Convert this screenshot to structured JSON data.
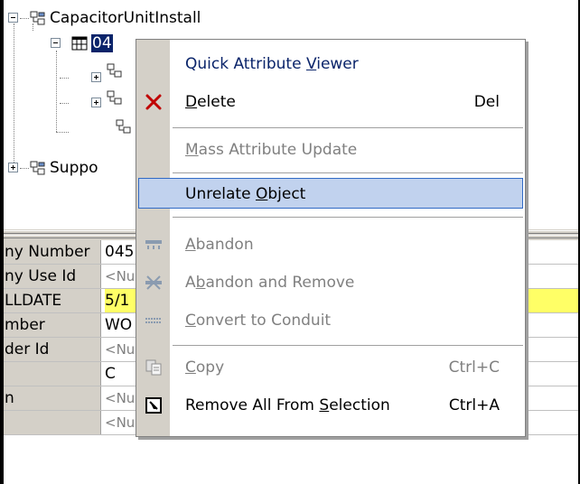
{
  "tree": {
    "root_label": "CapacitorUnitInstall",
    "selected_label": "04",
    "other_label": "Suppo"
  },
  "grid": {
    "rows": [
      {
        "name": "ny Number",
        "value": "045",
        "null": false,
        "highlight": false
      },
      {
        "name": "ny Use Id",
        "value": "<Nu",
        "null": true,
        "highlight": false
      },
      {
        "name": "LLDATE",
        "value": "5/1",
        "null": false,
        "highlight": true
      },
      {
        "name": "mber",
        "value": "WO",
        "null": false,
        "highlight": false
      },
      {
        "name": "der Id",
        "value": "<Nu",
        "null": true,
        "highlight": false
      },
      {
        "name": "",
        "value": "C",
        "null": false,
        "highlight": false
      },
      {
        "name": "n",
        "value": "<Null>",
        "null": true,
        "highlight": false
      },
      {
        "name": "",
        "value": "<Null>",
        "null": true,
        "highlight": false
      }
    ]
  },
  "menu": {
    "quick_attribute_viewer": {
      "pre": "Quick Attribute ",
      "acc": "V",
      "post": "iewer"
    },
    "delete": {
      "pre": "",
      "acc": "D",
      "post": "elete",
      "shortcut": "Del",
      "icon": "red-x-icon"
    },
    "mass_attribute_update": {
      "pre": "",
      "acc": "M",
      "post": "ass Attribute Update"
    },
    "unrelate_object": {
      "pre": "Unrelate ",
      "acc": "O",
      "post": "bject"
    },
    "abandon": {
      "pre": "",
      "acc": "A",
      "post": "bandon",
      "icon": "abandon-icon"
    },
    "abandon_and_remove": {
      "pre": "A",
      "acc": "b",
      "post": "andon and Remove",
      "icon": "abandon-remove-icon"
    },
    "convert_to_conduit": {
      "pre": "",
      "acc": "C",
      "post": "onvert to Conduit",
      "icon": "conduit-icon"
    },
    "copy": {
      "pre": "",
      "acc": "C",
      "post": "opy",
      "shortcut": "Ctrl+C",
      "icon": "copy-icon"
    },
    "remove_all_from_selection": {
      "pre": "Remove All From ",
      "acc": "S",
      "post": "election",
      "shortcut": "Ctrl+A",
      "icon": "remove-selection-icon"
    }
  },
  "colors": {
    "selection_blue": "#0a246a",
    "hover_fill": "#c1d2ee",
    "hover_border": "#316ac5",
    "highlight_yellow": "#ffff66",
    "menu_gutter": "#d4d0c8",
    "delete_red": "#c00000"
  }
}
